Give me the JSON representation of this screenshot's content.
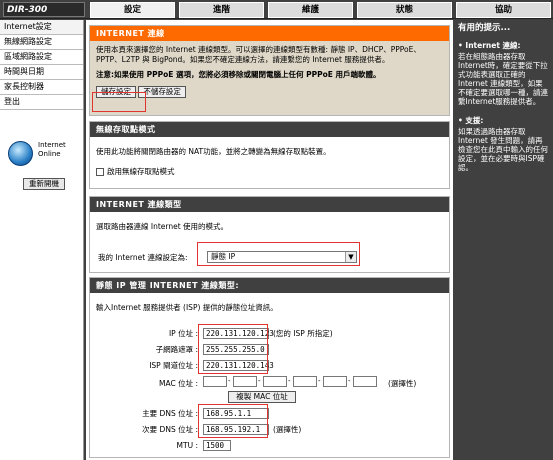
{
  "logo": "DIR-300",
  "nav": [
    "設定",
    "進階",
    "維護",
    "狀態",
    "協助"
  ],
  "sidebar": {
    "items": [
      "Internet設定",
      "無線網路設定",
      "區域網路設定",
      "時間與日期",
      "家長控制器",
      "登出"
    ],
    "online_text": "Internet Online",
    "reboot": "重新開機"
  },
  "internet_section": {
    "title": "INTERNET 連線",
    "text1": "使用本頁來選擇您的 Internet 連線類型。可以選擇的連線類型有數種: 靜態 IP、DHCP、PPPoE、PPTP、L2TP 與 BigPond。如果您不確定連線方法，請連繫您的 Internet 服務提供者。",
    "note": "注意:如果使用 PPPoE 選項，您將必須移除或關閉電腦上任何 PPPoE 用戶端軟體。",
    "save": "儲存設定",
    "nosave": "不儲存設定"
  },
  "wireless_ap": {
    "title": "無線存取點模式",
    "text": "使用此功能將關閉路由器的 NAT功能，並將之轉變為無線存取點裝置。",
    "checkbox_label": "啟用無線存取點模式"
  },
  "conn_type": {
    "title": "INTERNET 連線類型",
    "text": "選取路由器連線 Internet 使用的模式。",
    "label": "我的 Internet 連線設定為:",
    "value": "靜態 IP"
  },
  "static": {
    "title": "靜態 IP 管理 INTERNET 連線類型:",
    "intro": "輸入Internet 服務提供者 (ISP) 提供的靜態位址資訊。",
    "ip_label": "IP 位址 :",
    "ip_value": "220.131.120.123",
    "ip_note": "(您的 ISP 所指定)",
    "mask_label": "子網路遮罩 :",
    "mask_value": "255.255.255.0",
    "gw_label": "ISP 閘道位址 :",
    "gw_value": "220.131.120.143",
    "mac_label": "MAC 位址 :",
    "mac_note": "(選擇性)",
    "clone": "複製 MAC 位址",
    "dns1_label": "主要 DNS 位址 :",
    "dns1_value": "168.95.1.1",
    "dns2_label": "次要 DNS 位址 :",
    "dns2_value": "168.95.192.1",
    "dns2_note": "(選擇性)",
    "mtu_label": "MTU :",
    "mtu_value": "1500"
  },
  "help": {
    "title": "有用的提示...",
    "bullet1_title": "• Internet 連線:",
    "bullet1_text": "若在組態路由器存取Internet時，確定要從下拉式功能表選取正確的 Internet 連線類型，如果不確定要選取哪一種，請連繫Internet服務提供者。",
    "bullet2_title": "• 支援:",
    "bullet2_text": "如果透過路由器存取Internet 發生問題，請再檢查您在此頁中輸入的任何設定，並在必要時與ISP確認。"
  }
}
